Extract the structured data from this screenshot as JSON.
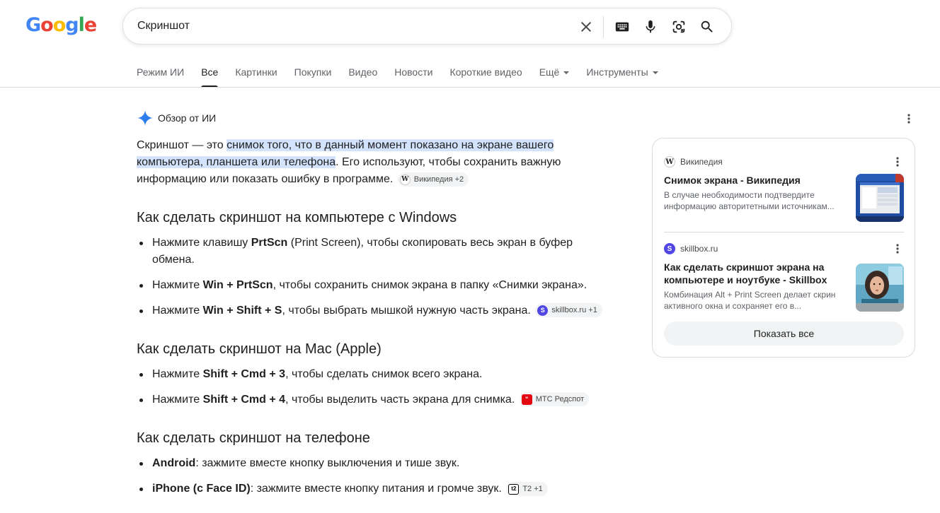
{
  "logo": {
    "text": "Google"
  },
  "search": {
    "value": "Скриншот"
  },
  "tabs": [
    {
      "label": "Режим ИИ"
    },
    {
      "label": "Все"
    },
    {
      "label": "Картинки"
    },
    {
      "label": "Покупки"
    },
    {
      "label": "Видео"
    },
    {
      "label": "Новости"
    },
    {
      "label": "Короткие видео"
    },
    {
      "label": "Ещё"
    },
    {
      "label": "Инструменты"
    }
  ],
  "ai": {
    "title": "Обзор от ИИ",
    "intro": {
      "pre": "Скриншот — это ",
      "highlight": "снимок того, что в данный момент показано на экране вашего компьютера, планшета или телефона",
      "post": ". Его используют, чтобы сохранить важную информацию или показать ошибку в программе.",
      "chip": "Википедия +2"
    },
    "windows": {
      "heading": "Как сделать скриншот на компьютере с Windows",
      "items": [
        {
          "pre": "Нажмите клавишу ",
          "bold": "PrtScn",
          "post": " (Print Screen), чтобы скопировать весь экран в буфер обмена."
        },
        {
          "pre": "Нажмите ",
          "bold": "Win + PrtScn",
          "post": ", чтобы сохранить снимок экрана в папку «Снимки экрана»."
        },
        {
          "pre": "Нажмите ",
          "bold": "Win + Shift + S",
          "post": ", чтобы выбрать мышкой нужную часть экрана.",
          "chip": "skillbox.ru +1"
        }
      ]
    },
    "mac": {
      "heading": "Как сделать скриншот на Mac (Apple)",
      "items": [
        {
          "pre": "Нажмите ",
          "bold": "Shift + Cmd + 3",
          "post": ", чтобы сделать снимок всего экрана."
        },
        {
          "pre": "Нажмите ",
          "bold": "Shift + Cmd + 4",
          "post": ", чтобы выделить часть экрана для снимка.",
          "chip": "МТС Редспот"
        }
      ]
    },
    "phone": {
      "heading": "Как сделать скриншот на телефоне",
      "items": [
        {
          "bold": "Android",
          "post": ": зажмите вместе кнопку выключения и тише звук."
        },
        {
          "bold": "iPhone (с Face ID)",
          "post": ": зажмите вместе кнопку питания и громче звук.",
          "chip": "Т2 +1"
        }
      ]
    }
  },
  "sources": [
    {
      "site": "Википедия",
      "title": "Снимок экрана - Википедия",
      "snippet": "В случае необходимости подтвердите информацию авторитетными источникам..."
    },
    {
      "site": "skillbox.ru",
      "title": "Как сделать скриншот экрана на компьютере и ноутбуке - Skillbox",
      "snippet": "Комбинация Alt + Print Screen делает скрин активного окна и сохраняет его в..."
    }
  ],
  "show_all": "Показать все",
  "icons": {
    "clear": "close-icon",
    "keyboard": "keyboard-icon",
    "voice": "microphone-icon",
    "lens": "camera-lens-icon",
    "search": "search-icon",
    "ai": "sparkle-icon",
    "more": "more-vert-icon"
  },
  "colors": {
    "highlight": "#d3e3fd",
    "link_blue": "#4285f4",
    "logo_red": "#ea4335",
    "logo_yellow": "#fbbc05",
    "logo_green": "#34a853"
  }
}
